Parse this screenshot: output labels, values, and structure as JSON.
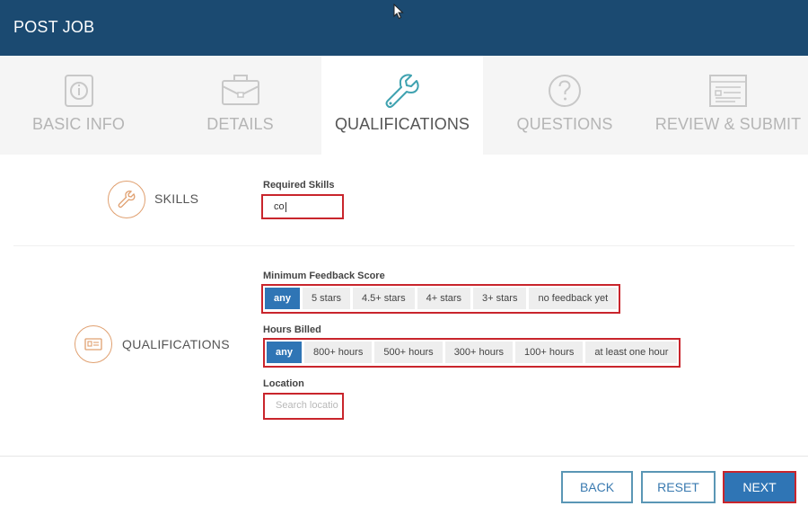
{
  "header": {
    "title": "POST JOB"
  },
  "tabs": [
    {
      "label": "BASIC INFO",
      "icon": "info-document-icon"
    },
    {
      "label": "DETAILS",
      "icon": "briefcase-icon"
    },
    {
      "label": "QUALIFICATIONS",
      "icon": "wrench-icon",
      "active": true
    },
    {
      "label": "QUESTIONS",
      "icon": "question-circle-icon"
    },
    {
      "label": "REVIEW & SUBMIT",
      "icon": "form-review-icon"
    }
  ],
  "skills": {
    "section_label": "SKILLS",
    "field_label": "Required Skills",
    "value": "co"
  },
  "qualifications": {
    "section_label": "QUALIFICATIONS",
    "feedback": {
      "label": "Minimum Feedback Score",
      "options": [
        "any",
        "5 stars",
        "4.5+ stars",
        "4+ stars",
        "3+ stars",
        "no feedback yet"
      ],
      "selected": "any"
    },
    "hours": {
      "label": "Hours Billed",
      "options": [
        "any",
        "800+ hours",
        "500+ hours",
        "300+ hours",
        "100+ hours",
        "at least one hour"
      ],
      "selected": "any"
    },
    "location": {
      "label": "Location",
      "placeholder": "Search locatio"
    }
  },
  "footer": {
    "back": "BACK",
    "reset": "RESET",
    "next": "NEXT"
  },
  "colors": {
    "header_bg": "#1b4a71",
    "active_tab_icon": "#3fa2b0",
    "primary": "#2f75b5",
    "highlight": "#c9252c",
    "section_icon": "#e0a070"
  }
}
